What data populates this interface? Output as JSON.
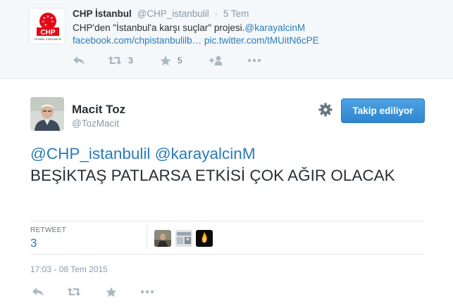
{
  "parent_tweet": {
    "name": "CHP İstanbul",
    "handle": "@CHP_istanbulil",
    "dot": "·",
    "time": "5 Tem",
    "text_prefix": "CHP'den \"İstanbul'a karşı suçlar\" projesi.",
    "mention": "@karayalcinM",
    "link1": "facebook.com/chpistanbulilb…",
    "link2": "pic.twitter.com/tMUitN6cPE",
    "retweet_count": "3",
    "favorite_count": "5",
    "avatar_logo_text": "CHP",
    "avatar_sub_text": "İSTANBUL İL BAŞKANLIĞI"
  },
  "main_tweet": {
    "name": "Macit Toz",
    "handle": "@TozMacit",
    "follow_label": "Takip ediliyor",
    "mention1": "@CHP_istanbulil",
    "mention2": "@karayalcinM",
    "text": "BEŞİKTAŞ PATLARSA ETKİSİ ÇOK AĞIR OLACAK",
    "retweet_label": "RETWEET",
    "retweet_count": "3",
    "date": "17:03 - 08 Tem 2015"
  },
  "icons": {
    "reply": "reply-icon",
    "retweet": "retweet-icon",
    "favorite": "star-icon",
    "follow": "follow-user-icon",
    "more": "more-dots-icon",
    "settings": "gear-icon"
  },
  "colors": {
    "link": "#2b7bb9",
    "follow_button": "#3b94d9",
    "muted": "#8899a6",
    "action_icon": "#aab8c2"
  }
}
